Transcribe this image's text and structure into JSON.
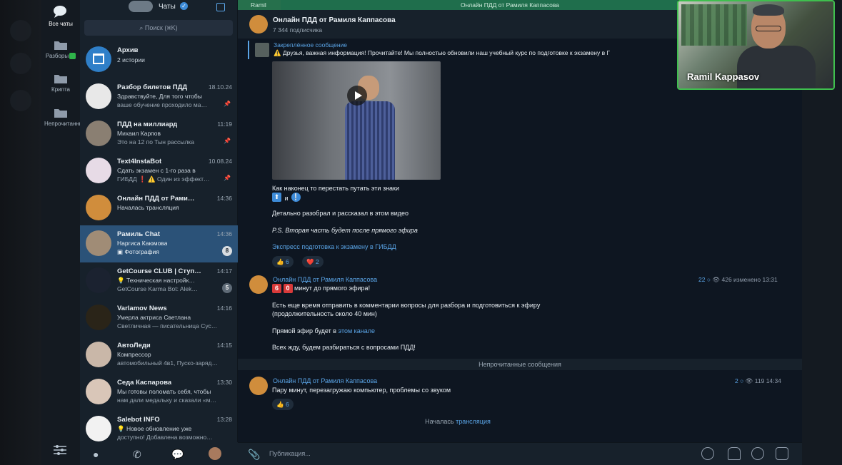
{
  "folders": {
    "items": [
      {
        "label": "Все чаты",
        "active": true
      },
      {
        "label": "Разборы",
        "badge": "✓"
      },
      {
        "label": "Крипта"
      },
      {
        "label": "Непрочитанные"
      }
    ]
  },
  "chatlist": {
    "header_title": "Чаты",
    "search_placeholder": "Поиск (⌘K)",
    "chats": [
      {
        "name": "Архив",
        "time": "",
        "line1": "2 истории",
        "line2": ""
      },
      {
        "name": "Разбор билетов ПДД",
        "time": "18.10.24",
        "line1": "Здравствуйте,  Для того чтобы",
        "line2": "ваше обучение проходило ма…"
      },
      {
        "name": "ПДД на миллиард",
        "time": "11:19",
        "line1": "Михаил Карпов",
        "line2": "Это на 12 по Тын рассылка"
      },
      {
        "name": "Text4InstaBot",
        "time": "10.08.24",
        "line1": "Сдать экзамен с 1-го раза в",
        "line2": "ГИБДД ❗ ⚠️ Один из эффект…"
      },
      {
        "name": "Онлайн ПДД от Рами…",
        "time": "14:36",
        "line1": "Началась трансляция",
        "line2": ""
      },
      {
        "name": "Рамиль Chat",
        "time": "14:36",
        "line1": "Наргиса Каюмова",
        "line2": "Фотография",
        "count": "8"
      },
      {
        "name": "GetCourse CLUB | Ступ…",
        "time": "14:17",
        "line1": "💡 Техническая настройк…",
        "line2": "GetCourse Karma Bot: Alek…",
        "count": "5"
      },
      {
        "name": "Varlamov News",
        "time": "14:16",
        "line1": "Умерла актриса Светлана",
        "line2": "Светличная — писательница Сус…"
      },
      {
        "name": "АвтоЛеди",
        "time": "14:15",
        "line1": "Компрессор",
        "line2": "автомобильный 4в1, Пуско-заряд…"
      },
      {
        "name": "Седа Каспарова",
        "time": "13:30",
        "line1": "Мы готовы поломать себя, чтобы",
        "line2": "нам дали медальку и сказали «м…"
      },
      {
        "name": "Salebot INFO",
        "time": "13:28",
        "line1": "💡 Новое обновление уже",
        "line2": "доступно!  Добавлена возможно…"
      }
    ]
  },
  "topstrip": {
    "live": "Ramil",
    "title": "Онлайн ПДД от Рамиля Каппасова"
  },
  "channel": {
    "name": "Онлайн ПДД от Рамиля Каппасова",
    "subscribers": "7 344 подписчика"
  },
  "pinned": {
    "label": "Закреплённое сообщение",
    "text": "⚠️ Друзья, важная информация!  Прочитайте!  Мы полностью обновили наш учебный курс по подготовке к экзамену в Г"
  },
  "post1": {
    "line1": "Как наконец то перестать путать эти знаки",
    "icon_a": "⬆",
    "and": "и",
    "icon_b": "❕",
    "line2": "Детально разобрал и рассказал в этом видео",
    "line3": "P.S. Вторая часть будет после прямого эфира",
    "link": "Экспресс подготовка к экзамену в ГИБДД",
    "react1": "👍 6",
    "react2": "❤️ 2"
  },
  "post2": {
    "author": "Онлайн ПДД от Рамиля Каппасова",
    "meta_comments": "22",
    "meta_rest": "👁 426 изменено 13:31",
    "countdown_digits": [
      "6",
      "0"
    ],
    "countdown_text": "минут до прямого эфира!",
    "line1": "Есть еще время отправить в комментарии вопросы для разбора и подготовиться к эфиру",
    "line2": "(продолжительность около 40 мин)",
    "line3_pre": "Прямой эфир будет в",
    "line3_link": "этом канале",
    "line4": "Всех жду, будем разбираться с вопросами ПДД!"
  },
  "unread_label": "Непрочитанные сообщения",
  "post3": {
    "author": "Онлайн ПДД от Рамиля Каппасова",
    "meta_comments": "2",
    "meta_rest": "👁 119 14:34",
    "text": "Пару минут, перезагружаю компьютер, проблемы со звуком",
    "react": "👍 6"
  },
  "live_note": {
    "pre": "Началась",
    "link": "трансляция"
  },
  "composer": {
    "placeholder": "Публикация..."
  },
  "webcam": {
    "name": "Ramil Kappasov"
  },
  "colors": {
    "accent": "#5aa4e6",
    "selected": "#2b5278",
    "live_green": "#3fbf4e"
  }
}
